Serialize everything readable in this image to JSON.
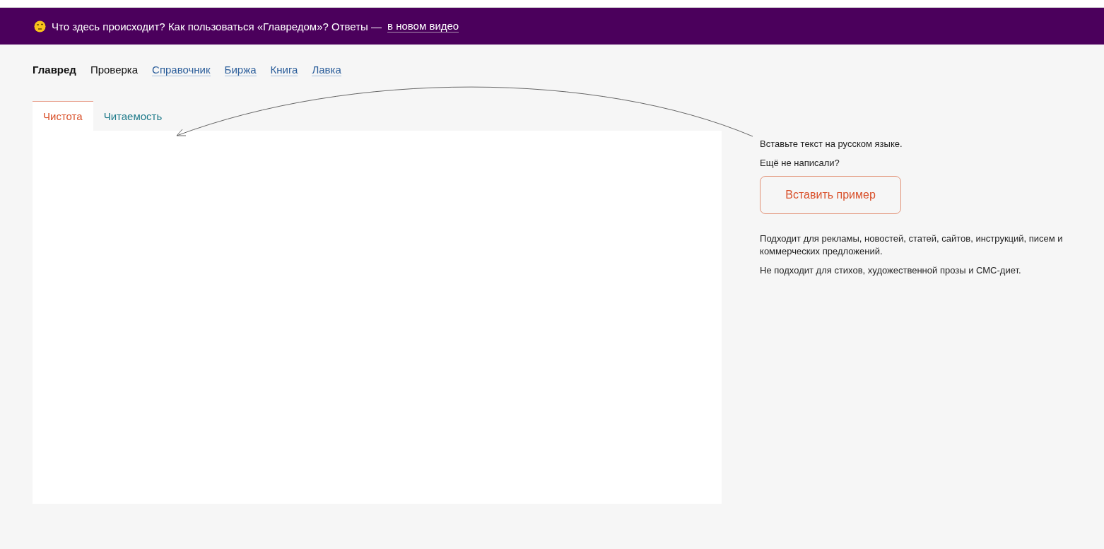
{
  "banner": {
    "text": "Что здесь происходит? Как пользоваться «Главредом»? Ответы —",
    "link": "в новом видео"
  },
  "nav": [
    {
      "label": "Главред",
      "kind": "current"
    },
    {
      "label": "Проверка",
      "kind": "text"
    },
    {
      "label": "Справочник",
      "kind": "link"
    },
    {
      "label": "Биржа",
      "kind": "link"
    },
    {
      "label": "Книга",
      "kind": "link"
    },
    {
      "label": "Лавка",
      "kind": "link"
    }
  ],
  "tabs": [
    {
      "label": "Чистота",
      "selected": true
    },
    {
      "label": "Читаемость",
      "selected": false
    }
  ],
  "side": {
    "hint": "Вставьте текст на русском языке.",
    "question": "Ещё не написали?",
    "button": "Вставить пример",
    "notes": [
      "Подходит для рекламы, новостей, статей, сайтов, инструкций, писем и коммерческих предложений.",
      "Не подходит для стихов, художественной прозы и СМС-диет."
    ]
  }
}
